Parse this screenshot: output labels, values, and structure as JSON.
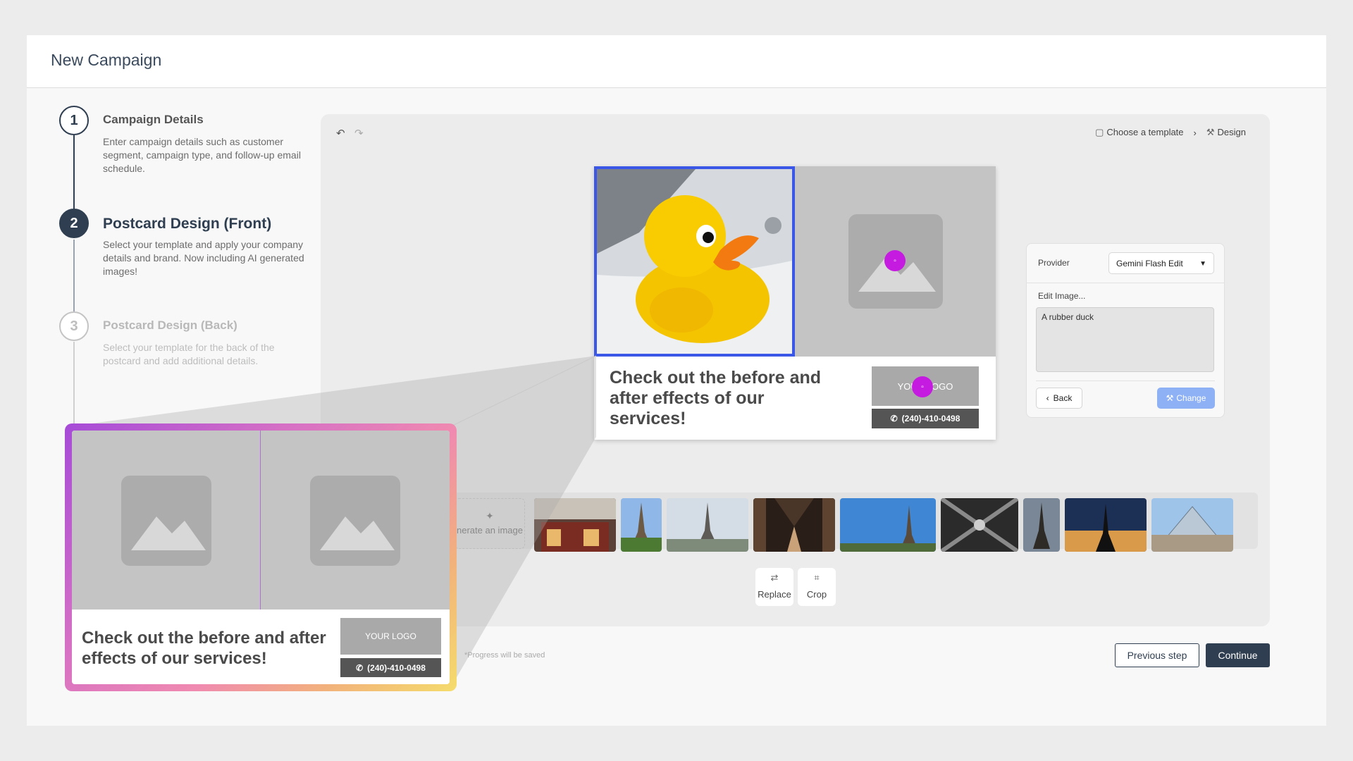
{
  "header": {
    "title": "New Campaign"
  },
  "steps": [
    {
      "number": "1",
      "title": "Campaign Details",
      "description": "Enter campaign details such as customer segment, campaign type, and follow-up email schedule."
    },
    {
      "number": "2",
      "title": "Postcard Design (Front)",
      "description": "Select your template and apply your company details and brand. Now including AI generated images!"
    },
    {
      "number": "3",
      "title": "Postcard Design (Back)",
      "description": "Select your template for the back of the postcard  and add additional details."
    }
  ],
  "editor": {
    "undo_icon": "↶",
    "redo_icon": "↷",
    "breadcrumb": {
      "template_label": "Choose a template",
      "separator": "›",
      "design_label": "Design"
    }
  },
  "postcard": {
    "headline": "Check out the before and after effects of our services!",
    "logo_text": "YOUR LOGO",
    "phone": "(240)-410-0498"
  },
  "panel": {
    "provider_label": "Provider",
    "provider_value": "Gemini Flash Edit",
    "edit_label": "Edit Image...",
    "prompt_value": "A rubber duck",
    "back_label": "Back",
    "change_label": "Change"
  },
  "strip": {
    "generate_label": "nerate an image"
  },
  "tools": {
    "replace_label": "Replace",
    "crop_label": "Crop"
  },
  "footer": {
    "progress_note": "*Progress will be saved",
    "previous_label": "Previous step",
    "continue_label": "Continue"
  },
  "zoom": {
    "headline": "Check out the before and after effects of our services!",
    "logo_text": "YOUR LOGO",
    "phone": "(240)-410-0498"
  },
  "colors": {
    "accent": "#2f3e50",
    "selection": "#3a57e8",
    "marker": "#c51be0",
    "change_button": "#8eb1f6"
  }
}
